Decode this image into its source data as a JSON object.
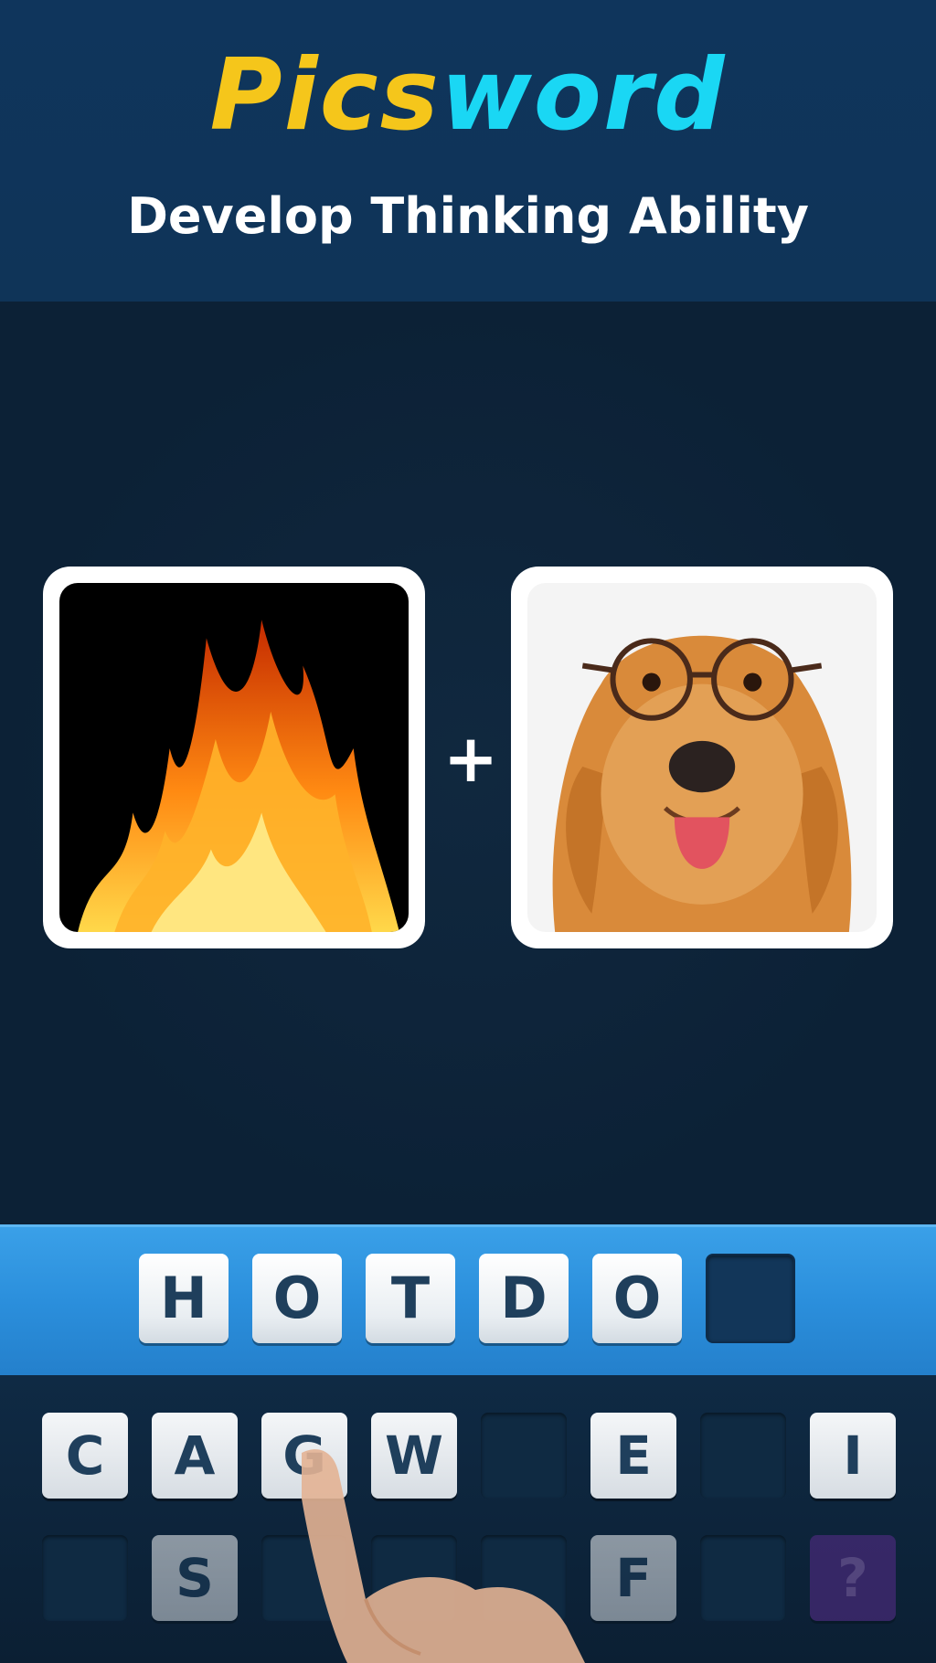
{
  "header": {
    "logo_part1": "Pics",
    "logo_part2": "word",
    "tagline": "Develop Thinking Ability"
  },
  "puzzle": {
    "plus": "+",
    "left_picture": "fire",
    "right_picture": "dog-with-glasses"
  },
  "answer": {
    "letters": [
      "H",
      "O",
      "T",
      "D",
      "O",
      ""
    ]
  },
  "keyboard": {
    "row1": [
      "C",
      "A",
      "G",
      "W",
      "",
      "E",
      "",
      "I"
    ],
    "row2": [
      "",
      "S",
      "",
      "",
      "",
      "F",
      "",
      "?"
    ]
  },
  "colors": {
    "logo_yellow": "#f5c61b",
    "logo_cyan": "#1ad7f4",
    "answer_bar": "#2b8fdc",
    "hint_key": "#5a2c8c"
  }
}
